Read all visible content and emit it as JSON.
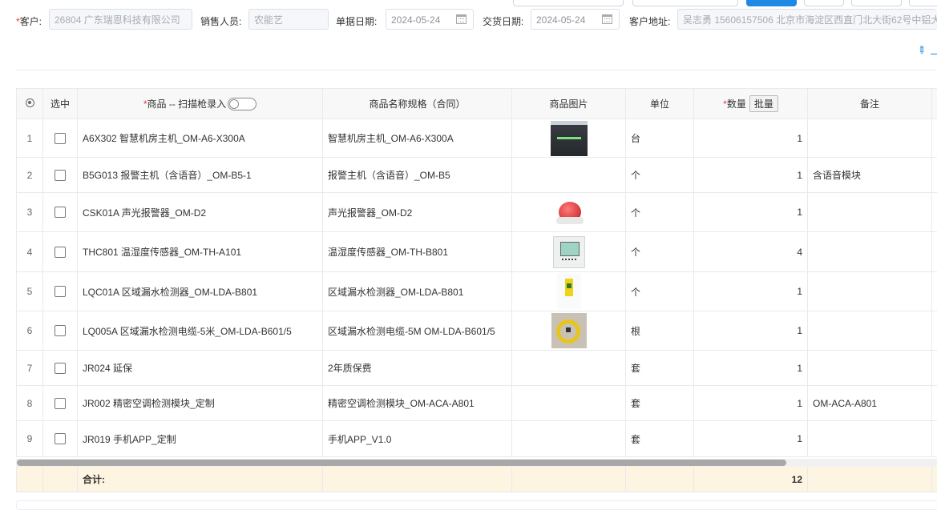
{
  "form": {
    "customer_label": "客户:",
    "customer_value": "26804 广东瑞恩科技有限公司",
    "sales_label": "销售人员:",
    "sales_value": "农能艺",
    "doc_date_label": "单据日期:",
    "doc_date_value": "2024-05-24",
    "delivery_date_label": "交货日期:",
    "delivery_date_value": "2024-05-24",
    "address_label": "客户地址:",
    "address_value": "吴志勇 15606157506 北京市海淀区西直门北大街62号中铝大"
  },
  "table": {
    "headers": {
      "selected": "选中",
      "product": "商品 -- 扫描枪录入",
      "spec": "商品名称规格（合同）",
      "image": "商品图片",
      "unit": "单位",
      "qty": "数量",
      "batch": "批量",
      "remark": "备注"
    },
    "rows": [
      {
        "idx": "1",
        "product": "A6X302 智慧机房主机_OM-A6-X300A",
        "spec": "智慧机房主机_OM-A6-X300A",
        "image": "host",
        "unit": "台",
        "qty": "1",
        "remark": ""
      },
      {
        "idx": "2",
        "product": "B5G013 报警主机（含语音）_OM-B5-1",
        "spec": "报警主机（含语音）_OM-B5",
        "image": "",
        "unit": "个",
        "qty": "1",
        "remark": "含语音模块"
      },
      {
        "idx": "3",
        "product": "CSK01A 声光报警器_OM-D2",
        "spec": "声光报警器_OM-D2",
        "image": "alarm",
        "unit": "个",
        "qty": "1",
        "remark": ""
      },
      {
        "idx": "4",
        "product": "THC801 温湿度传感器_OM-TH-A101",
        "spec": "温湿度传感器_OM-TH-B801",
        "image": "thermo",
        "unit": "个",
        "qty": "4",
        "remark": ""
      },
      {
        "idx": "5",
        "product": "LQC01A 区域漏水检测器_OM-LDA-B801",
        "spec": "区域漏水检测器_OM-LDA-B801",
        "image": "leak",
        "unit": "个",
        "qty": "1",
        "remark": ""
      },
      {
        "idx": "6",
        "product": "LQ005A 区域漏水检测电缆-5米_OM-LDA-B601/5",
        "spec": "区域漏水检测电缆-5M OM-LDA-B601/5",
        "image": "cable",
        "unit": "根",
        "qty": "1",
        "remark": ""
      },
      {
        "idx": "7",
        "product": "JR024 延保",
        "spec": "2年质保费",
        "image": "",
        "unit": "套",
        "qty": "1",
        "remark": ""
      },
      {
        "idx": "8",
        "product": "JR002 精密空调检测模块_定制",
        "spec": "精密空调检测模块_OM-ACA-A801",
        "image": "",
        "unit": "套",
        "qty": "1",
        "remark": "OM-ACA-A801"
      },
      {
        "idx": "9",
        "product": "JR019 手机APP_定制",
        "spec": "手机APP_V1.0",
        "image": "",
        "unit": "套",
        "qty": "1",
        "remark": ""
      }
    ],
    "footer": {
      "total_label": "合计:",
      "total_qty": "12"
    }
  },
  "colors": {
    "accent": "#1e88e5",
    "required": "#e53935",
    "footer_bg": "#fdf4e1"
  }
}
